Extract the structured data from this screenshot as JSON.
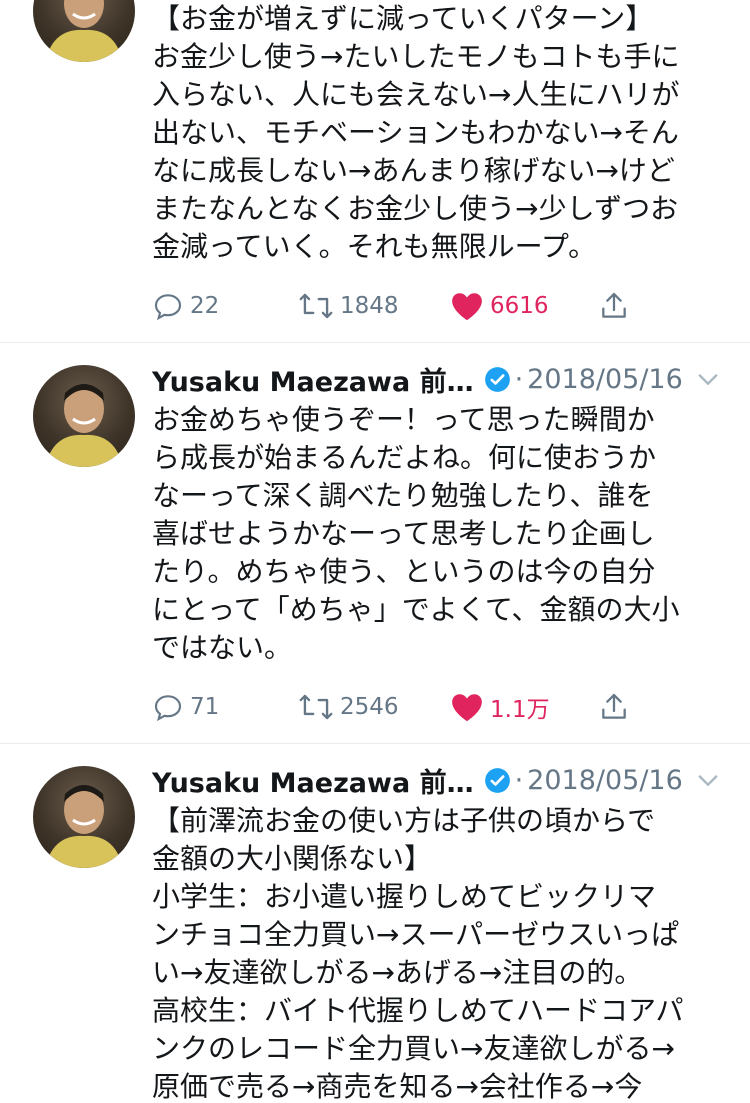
{
  "colors": {
    "like": "#e0245e",
    "muted": "#657786",
    "verified": "#1da1f2",
    "text": "#14171a"
  },
  "tweets": [
    {
      "text": "【お金が増えずに減っていくパターン】\nお金少し使う→たいしたモノもコトも手に\n入らない、人にも会えない→人生にハリが\n出ない、モチベーションもわかない→そん\nなに成長しない→あんまり稼げない→けど\nまたなんとなくお金少し使う→少しずつお\n金減っていく。それも無限ループ。",
      "replies": "22",
      "retweets": "1848",
      "likes": "6616"
    },
    {
      "name": "Yusaku Maezawa 前…",
      "date": "2018/05/16",
      "text": "お金めちゃ使うぞー！って思った瞬間か\nら成長が始まるんだよね。何に使おうか\nなーって深く調べたり勉強したり、誰を\n喜ばせようかなーって思考したり企画し\nたり。めちゃ使う、というのは今の自分\nにとって「めちゃ」でよくて、金額の大小\nではない。",
      "replies": "71",
      "retweets": "2546",
      "likes": "1.1万"
    },
    {
      "name": "Yusaku Maezawa 前…",
      "date": "2018/05/16",
      "text": "【前澤流お金の使い方は子供の頃からで\n金額の大小関係ない】\n小学生：お小遣い握りしめてビックリマ\nンチョコ全力買い→スーパーゼウスいっぱ\nい→友達欲しがる→あげる→注目の的。\n高校生：バイト代握りしめてハードコアパ\nンクのレコード全力買い→友達欲しがる→\n原価で売る→商売を知る→会社作る→今"
    }
  ]
}
